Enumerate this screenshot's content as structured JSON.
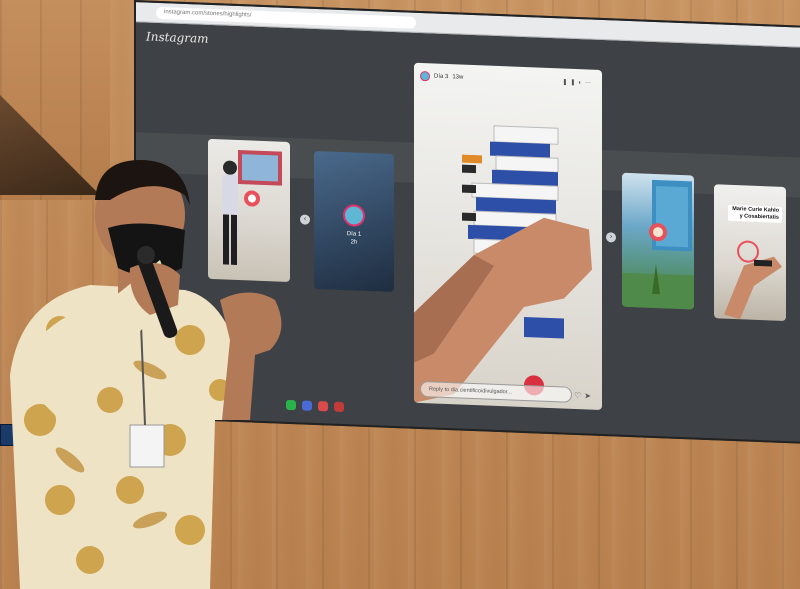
{
  "screen": {
    "app_logo": "Instagram",
    "url_text": "instagram.com/stories/highlights/",
    "stories": [
      {
        "id": "story-1"
      },
      {
        "id": "story-2",
        "caption_line1": "Día 1",
        "caption_line2": "2h"
      },
      {
        "id": "story-main",
        "header_user": "Día 3",
        "header_time": "13w",
        "reply_placeholder": "Reply to dia.cientificoidivulgador..."
      },
      {
        "id": "story-4"
      },
      {
        "id": "story-5",
        "label": "Marie Curie Kahlo y Cosabiertatis"
      }
    ],
    "controls_icons": [
      "pause-icon",
      "mute-icon",
      "more-icon"
    ],
    "reply_icons": [
      "heart-icon",
      "send-icon"
    ]
  },
  "colors": {
    "wood": "#c18a58",
    "screen_bg": "#3e4246",
    "ig_ring": "#e1306c",
    "shirt_base": "#efe3c5",
    "shirt_pattern": "#c99a3a"
  }
}
